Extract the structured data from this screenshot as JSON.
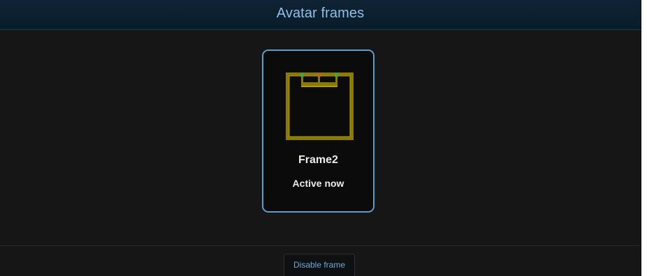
{
  "header": {
    "title": "Avatar frames"
  },
  "frames": [
    {
      "name": "Frame2",
      "status": "Active now",
      "icon": "crown-frame-icon",
      "colors": {
        "frame": "#8a7a00",
        "frame_highlight": "#b09a10",
        "gem_left": "#3aa84a",
        "gem_center": "#c0602a",
        "gem_right": "#3aa84a"
      }
    }
  ],
  "footer": {
    "disable_label": "Disable frame"
  },
  "colors": {
    "accent": "#5a9fd0",
    "header_text": "#8fc1e8",
    "link_text": "#6ea9d6",
    "background": "#161616"
  }
}
